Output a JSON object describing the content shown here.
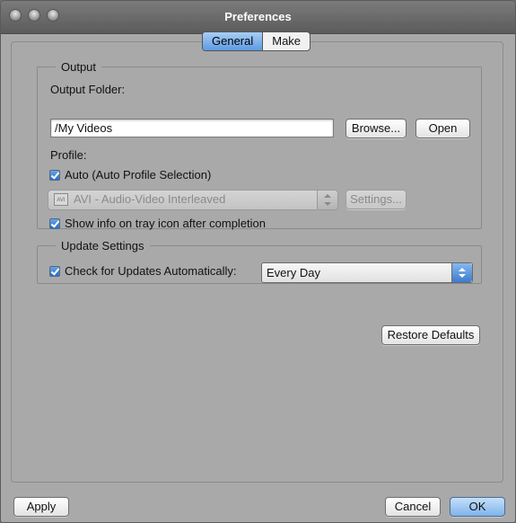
{
  "window": {
    "title": "Preferences"
  },
  "tabs": [
    {
      "label": "General",
      "active": true
    },
    {
      "label": "Make",
      "active": false
    }
  ],
  "output": {
    "group_label": "Output",
    "folder_label": "Output Folder:",
    "folder_value": "/My Videos",
    "browse_label": "Browse...",
    "open_label": "Open",
    "profile_label": "Profile:",
    "auto_label": "Auto (Auto Profile Selection)",
    "auto_checked": true,
    "profile_selected": "AVI - Audio-Video Interleaved",
    "profile_icon": "AVI",
    "settings_label": "Settings...",
    "tray_label": "Show info on tray icon after completion",
    "tray_checked": true
  },
  "update": {
    "group_label": "Update Settings",
    "check_label": "Check for Updates Automatically:",
    "check_checked": true,
    "frequency_selected": "Every Day"
  },
  "buttons": {
    "restore_defaults": "Restore Defaults",
    "apply": "Apply",
    "cancel": "Cancel",
    "ok": "OK"
  },
  "colors": {
    "accent": "#5d9ae3",
    "window_bg": "#a9a9a9",
    "titlebar": "#6a6a6a"
  }
}
